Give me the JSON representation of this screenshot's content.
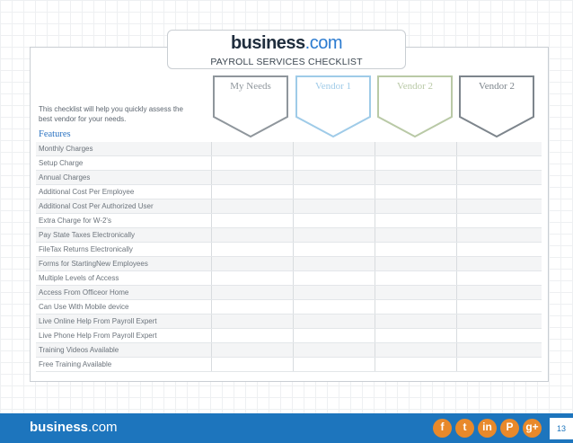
{
  "header": {
    "logo_main": "business",
    "logo_suffix": ".com",
    "title": "PAYROLL SERVICES CHECKLIST"
  },
  "columns": [
    {
      "label": "My Needs",
      "color": "#8f969c"
    },
    {
      "label": "Vendor 1",
      "color": "#9fcbe8"
    },
    {
      "label": "Vendor 2",
      "color": "#b9c9a6"
    },
    {
      "label": "Vendor 2",
      "color": "#7d858c"
    }
  ],
  "intro": "This checklist will help you quickly assess the best vendor for your needs.",
  "features_title": "Features",
  "features": [
    "Monthly Charges",
    "Setup Charge",
    "Annual Charges",
    "Additional Cost Per Employee",
    "Additional Cost Per Authorized User",
    "Extra Charge for W-2's",
    "Pay State Taxes Electronically",
    "FileTax Returns Electronically",
    "Forms for StartingNew Employees",
    "Multiple Levels of Access",
    "Access From Officeor Home",
    "Can Use With Mobile device",
    "Live Online Help From Payroll Expert",
    "Live Phone Help From Payroll Expert",
    "Training Videos Available",
    "Free Training Available"
  ],
  "footer": {
    "logo_main": "business",
    "logo_suffix": ".com",
    "page_number": "13",
    "social": [
      {
        "icon": "facebook-icon",
        "glyph": "f",
        "color": "#e8892b"
      },
      {
        "icon": "twitter-icon",
        "glyph": "t",
        "color": "#e8892b"
      },
      {
        "icon": "linkedin-icon",
        "glyph": "in",
        "color": "#e8892b"
      },
      {
        "icon": "pinterest-icon",
        "glyph": "P",
        "color": "#e8892b"
      },
      {
        "icon": "google-plus-icon",
        "glyph": "g+",
        "color": "#e8892b"
      }
    ]
  }
}
